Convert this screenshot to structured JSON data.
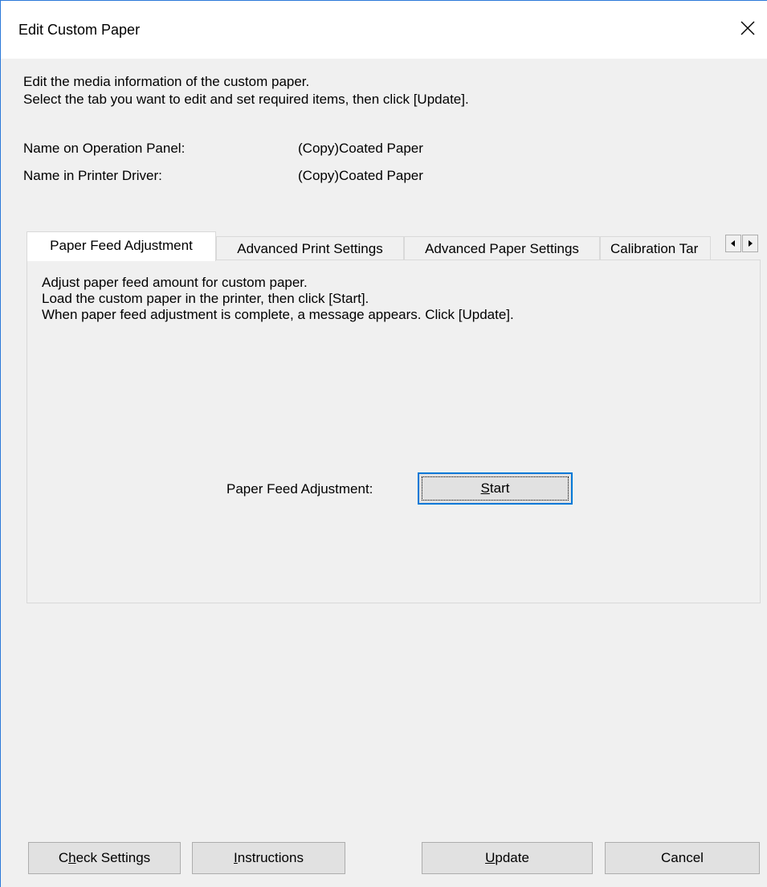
{
  "window": {
    "title": "Edit Custom Paper",
    "close_icon": "close-icon"
  },
  "description": {
    "line1": "Edit the media information of the custom paper.",
    "line2": "Select the tab you want to edit and set required items, then click [Update]."
  },
  "info": {
    "operation_panel_label": "Name on Operation Panel:",
    "operation_panel_value": "(Copy)Coated Paper",
    "printer_driver_label": "Name in Printer Driver:",
    "printer_driver_value": "(Copy)Coated Paper"
  },
  "tabs": [
    {
      "label": "Paper Feed Adjustment",
      "active": true
    },
    {
      "label": "Advanced Print Settings",
      "active": false
    },
    {
      "label": "Advanced Paper Settings",
      "active": false
    },
    {
      "label": "Calibration Tar",
      "active": false
    }
  ],
  "tab_scroll": {
    "left_icon": "arrow-left-icon",
    "right_icon": "arrow-right-icon"
  },
  "panel": {
    "line1": "Adjust paper feed amount for custom paper.",
    "line2": "Load the custom paper in the printer, then click [Start].",
    "line3": "When paper feed adjustment is complete, a message appears. Click [Update].",
    "adjust_label": "Paper Feed Adjustment:",
    "start_mnemonic": "S",
    "start_rest": "tart"
  },
  "buttons": {
    "check_mnemonic": "h",
    "check_pre": "C",
    "check_post": "eck Settings",
    "instructions_mnemonic": "I",
    "instructions_rest": "nstructions",
    "update_mnemonic": "U",
    "update_rest": "pdate",
    "cancel": "Cancel"
  },
  "colors": {
    "accent": "#0078d7",
    "dialog_bg": "#f0f0f0",
    "button_bg": "#e1e1e1"
  }
}
